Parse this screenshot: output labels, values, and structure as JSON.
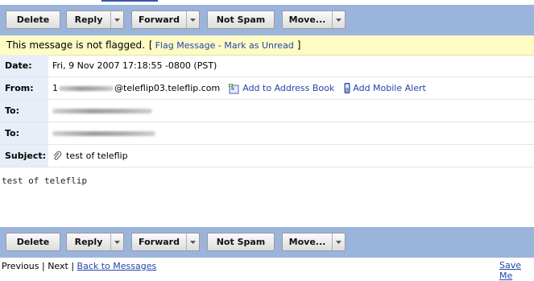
{
  "toolbar": {
    "delete": "Delete",
    "reply": "Reply",
    "forward": "Forward",
    "not_spam": "Not Spam",
    "move": "Move..."
  },
  "flag": {
    "status": "This message is not flagged.",
    "open_bracket": "[",
    "flag_message": "Flag Message",
    "sep": " - ",
    "mark_unread": "Mark as Unread",
    "close_bracket": "]"
  },
  "headers": {
    "date_label": "Date:",
    "date_value": "Fri, 9 Nov 2007 17:18:55 -0800 (PST)",
    "from_label": "From:",
    "from_prefix": "1",
    "from_domain": "@teleflip03.teleflip.com",
    "add_address_book": "Add to Address Book",
    "add_mobile_alert": "Add Mobile Alert",
    "to_label": "To:",
    "subject_label": "Subject:",
    "subject_value": "test of teleflip"
  },
  "message_body": "test of teleflip",
  "footer": {
    "previous": "Previous",
    "sep1": " | ",
    "next": "Next",
    "sep2": " | ",
    "back": "Back to Messages",
    "save": "Save Me"
  },
  "icons": {
    "dropdown": "chevron-down-icon",
    "address_book": "address-book-icon",
    "mobile": "mobile-phone-icon",
    "attachment": "paperclip-icon"
  },
  "colors": {
    "toolbar_bg": "#9bb4dc",
    "flag_bg": "#fffbc5",
    "link": "#2244aa"
  }
}
